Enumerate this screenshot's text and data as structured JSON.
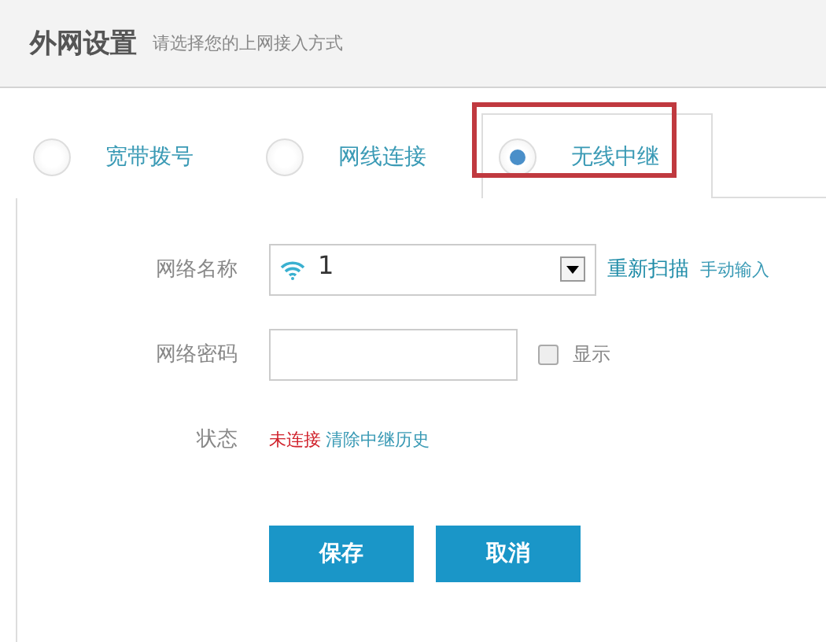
{
  "header": {
    "title": "外网设置",
    "subtitle": "请选择您的上网接入方式"
  },
  "tabs": [
    {
      "label": "宽带拨号",
      "selected": false,
      "highlighted": false
    },
    {
      "label": "网线连接",
      "selected": false,
      "highlighted": false
    },
    {
      "label": "无线中继",
      "selected": true,
      "highlighted": true
    }
  ],
  "form": {
    "network_name": {
      "label": "网络名称",
      "value": "1",
      "links": [
        "重新扫描",
        "手动输入"
      ]
    },
    "password": {
      "label": "网络密码",
      "show_label": "显示",
      "show_checked": false
    },
    "status": {
      "label": "状态",
      "value": "未连接",
      "link": "清除中继历史"
    }
  },
  "buttons": [
    "保存",
    "取消"
  ]
}
